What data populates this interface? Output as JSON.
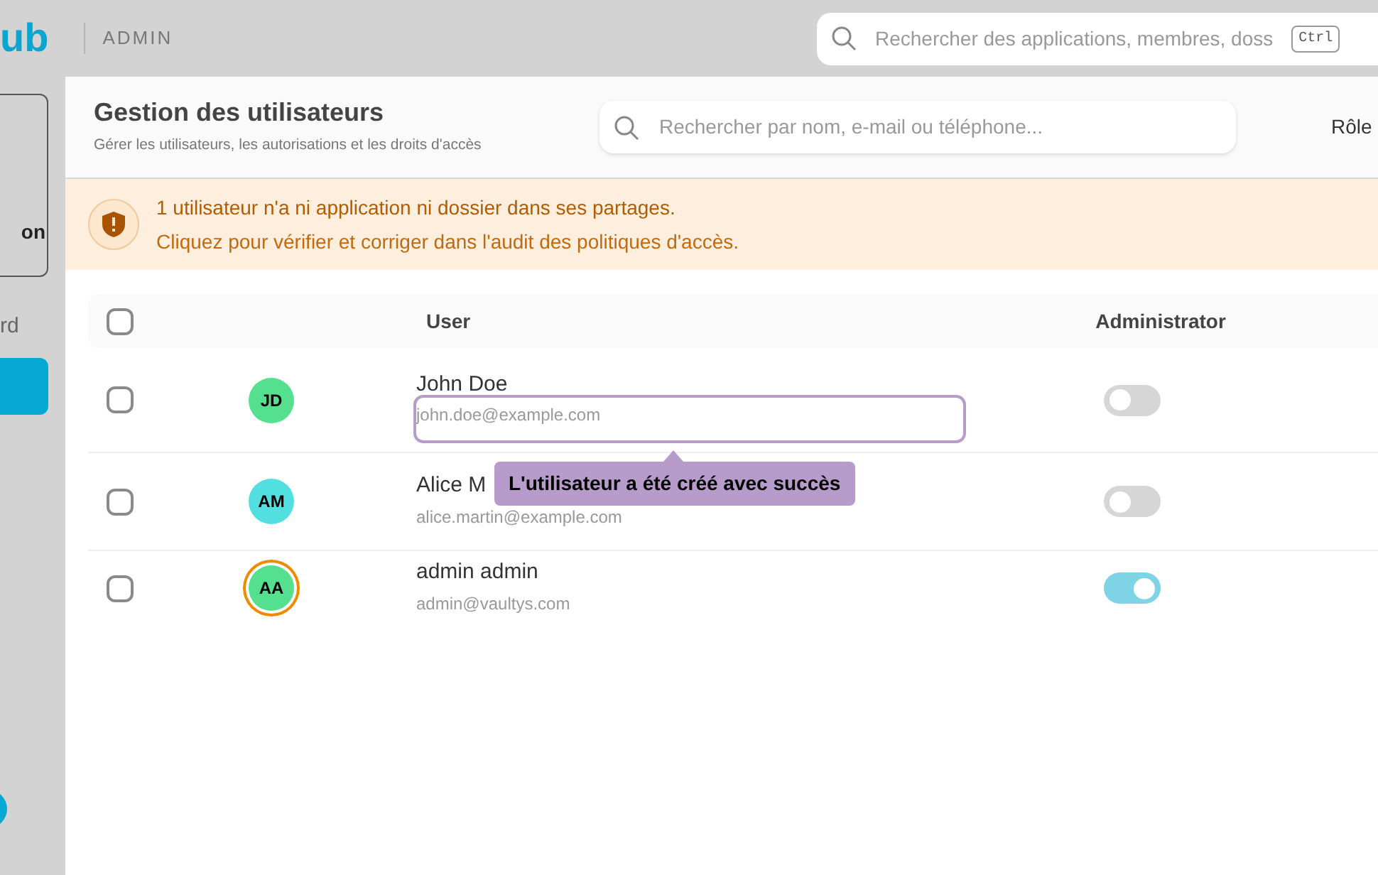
{
  "top_bar": {
    "logo": "ub",
    "section": "ADMIN",
    "search": {
      "placeholder": "Rechercher des applications, membres, doss",
      "shortcut": "Ctrl"
    }
  },
  "sidebar": {
    "card_label": "on",
    "link_label": "rd"
  },
  "header": {
    "title": "Gestion des utilisateurs",
    "subtitle": "Gérer les utilisateurs, les autorisations et les droits d'accès",
    "search": {
      "placeholder": "Rechercher par nom, e-mail ou téléphone..."
    },
    "filter_label": "Rôle"
  },
  "alert": {
    "title": "1 utilisateur n'a ni application ni dossier dans ses partages.",
    "message": "Cliquez pour vérifier et corriger dans l'audit des politiques d'accès."
  },
  "table": {
    "columns": [
      "User",
      "Administrator"
    ],
    "header_checked": false,
    "rows": [
      {
        "initials": "JD",
        "color": "#55e08f",
        "name": "John Doe",
        "email": "john.doe@example.com",
        "checked": false,
        "admin": false,
        "current": false,
        "highlighted": true
      },
      {
        "initials": "AM",
        "color": "#52dfe0",
        "name": "Alice M",
        "email": "alice.martin@example.com",
        "checked": false,
        "admin": false,
        "current": false,
        "highlighted": false
      },
      {
        "initials": "AA",
        "color": "#55e08f",
        "name": "admin admin",
        "email": "admin@vaultys.com",
        "checked": false,
        "admin": true,
        "current": true,
        "highlighted": false
      }
    ]
  },
  "tooltip": {
    "text": "L'utilisateur a été créé avec succès"
  }
}
